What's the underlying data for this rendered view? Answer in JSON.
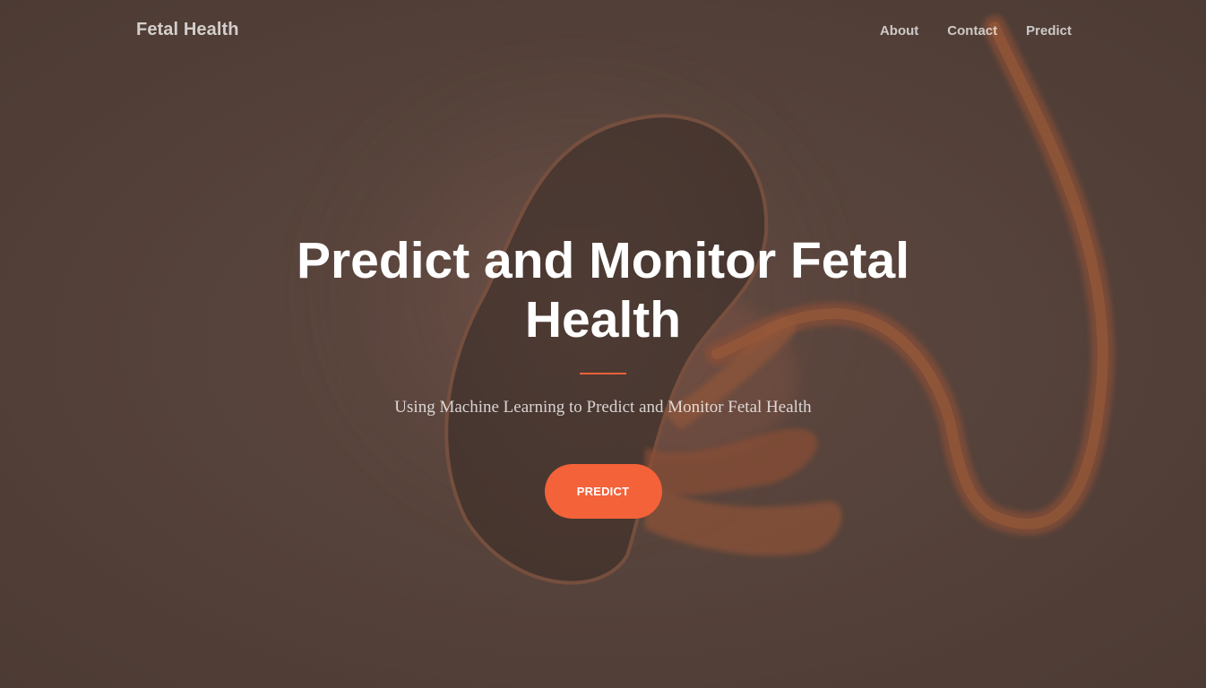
{
  "navbar": {
    "brand": "Fetal Health",
    "links": [
      {
        "label": "About"
      },
      {
        "label": "Contact"
      },
      {
        "label": "Predict"
      }
    ]
  },
  "hero": {
    "title": "Predict and Monitor Fetal Health",
    "subtitle": "Using Machine Learning to Predict and Monitor Fetal Health",
    "cta_label": "PREDICT"
  },
  "colors": {
    "accent": "#f4623a",
    "background": "#5a463d",
    "text": "#ffffff"
  }
}
